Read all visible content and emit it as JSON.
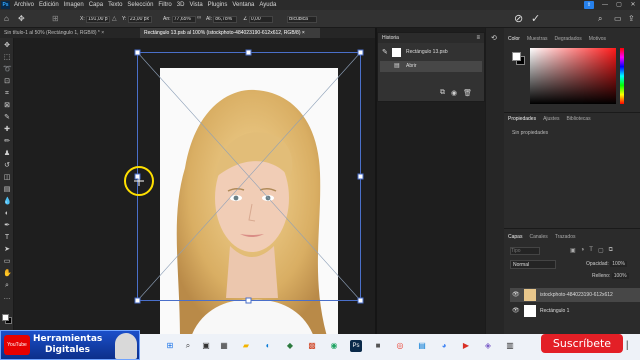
{
  "menubar": {
    "logo": "Ps",
    "items": [
      "Archivo",
      "Edición",
      "Imagen",
      "Capa",
      "Texto",
      "Selección",
      "Filtro",
      "3D",
      "Vista",
      "Plugins",
      "Ventana",
      "Ayuda"
    ]
  },
  "window_controls": {
    "minimize": "—",
    "maximize": "▢",
    "close": "✕"
  },
  "options": {
    "x_label": "X:",
    "x_value": "191,00 px",
    "y_label": "Y:",
    "y_value": "23,00 px",
    "w_label": "An:",
    "w_value": "77,65%",
    "h_label": "Al:",
    "h_value": "86,78%",
    "angle_label": "∠",
    "angle_value": "0,00",
    "interp_value": "Bicúbica",
    "cancel_icon": "⊘",
    "commit_icon": "✓"
  },
  "tabs": [
    {
      "label": "Sin título-1 al 50% (Rectángulo 1, RGB/8) *",
      "close": "×"
    },
    {
      "label": "Rectángulo 13.psb al 100% (istockphoto-484023190-612x612, RGB/8)",
      "close": "×"
    }
  ],
  "history": {
    "title": "Historia",
    "rows": [
      "Rectángulo 13.psb",
      "Abrir"
    ]
  },
  "color_panel": {
    "tabs": [
      "Color",
      "Muestras",
      "Degradados",
      "Motivos"
    ],
    "fg_color": "#ffffff",
    "bg_color": "#000000"
  },
  "properties": {
    "tabs": [
      "Propiedades",
      "Ajustes",
      "Bibliotecas"
    ],
    "empty_text": "Sin propiedades"
  },
  "layers": {
    "tabs": [
      "Capas",
      "Canales",
      "Trazados"
    ],
    "search_placeholder": "Tipo",
    "blend_mode": "Normal",
    "opacity_label": "Opacidad:",
    "opacity_value": "100%",
    "fill_label": "Relleno:",
    "fill_value": "100%",
    "rows": [
      {
        "name": "istockphoto-484023190-612x612"
      },
      {
        "name": "Rectángulo 1"
      }
    ]
  },
  "banner": {
    "logo_text": "YouTube",
    "title": "Herramientas",
    "subtitle": "Digitales"
  },
  "subscribe_label": "Suscríbete",
  "colors": {
    "accent": "#2680eb",
    "transform_frame": "#4a6fc9",
    "cursor_ring": "#ffe000",
    "subscribe_bg": "#e31f26"
  }
}
